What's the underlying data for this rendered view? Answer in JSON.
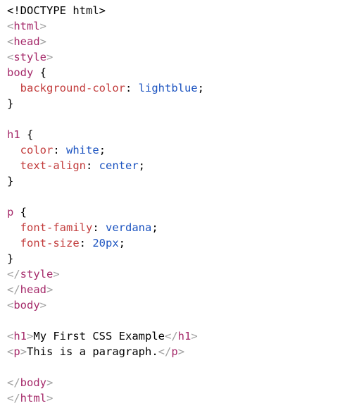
{
  "colors": {
    "plain": "#000000",
    "bracket": "#a0a0a0",
    "tag": "#a52a6a",
    "selector": "#a52a6a",
    "property": "#c23b3b",
    "value": "#1b53c0"
  },
  "code_lines": [
    [
      {
        "t": "plain",
        "v": "<!DOCTYPE html>"
      }
    ],
    [
      {
        "t": "bracket",
        "v": "<"
      },
      {
        "t": "tag",
        "v": "html"
      },
      {
        "t": "bracket",
        "v": ">"
      }
    ],
    [
      {
        "t": "bracket",
        "v": "<"
      },
      {
        "t": "tag",
        "v": "head"
      },
      {
        "t": "bracket",
        "v": ">"
      }
    ],
    [
      {
        "t": "bracket",
        "v": "<"
      },
      {
        "t": "tag",
        "v": "style"
      },
      {
        "t": "bracket",
        "v": ">"
      }
    ],
    [
      {
        "t": "selector",
        "v": "body"
      },
      {
        "t": "punct",
        "v": " {"
      }
    ],
    [
      {
        "t": "plain",
        "v": "  "
      },
      {
        "t": "property",
        "v": "background-color"
      },
      {
        "t": "punct",
        "v": ": "
      },
      {
        "t": "value",
        "v": "lightblue"
      },
      {
        "t": "punct",
        "v": ";"
      }
    ],
    [
      {
        "t": "punct",
        "v": "}"
      }
    ],
    [],
    [
      {
        "t": "selector",
        "v": "h1"
      },
      {
        "t": "punct",
        "v": " {"
      }
    ],
    [
      {
        "t": "plain",
        "v": "  "
      },
      {
        "t": "property",
        "v": "color"
      },
      {
        "t": "punct",
        "v": ": "
      },
      {
        "t": "value",
        "v": "white"
      },
      {
        "t": "punct",
        "v": ";"
      }
    ],
    [
      {
        "t": "plain",
        "v": "  "
      },
      {
        "t": "property",
        "v": "text-align"
      },
      {
        "t": "punct",
        "v": ": "
      },
      {
        "t": "value",
        "v": "center"
      },
      {
        "t": "punct",
        "v": ";"
      }
    ],
    [
      {
        "t": "punct",
        "v": "}"
      }
    ],
    [],
    [
      {
        "t": "selector",
        "v": "p"
      },
      {
        "t": "punct",
        "v": " {"
      }
    ],
    [
      {
        "t": "plain",
        "v": "  "
      },
      {
        "t": "property",
        "v": "font-family"
      },
      {
        "t": "punct",
        "v": ": "
      },
      {
        "t": "value",
        "v": "verdana"
      },
      {
        "t": "punct",
        "v": ";"
      }
    ],
    [
      {
        "t": "plain",
        "v": "  "
      },
      {
        "t": "property",
        "v": "font-size"
      },
      {
        "t": "punct",
        "v": ": "
      },
      {
        "t": "value",
        "v": "20px"
      },
      {
        "t": "punct",
        "v": ";"
      }
    ],
    [
      {
        "t": "punct",
        "v": "}"
      }
    ],
    [
      {
        "t": "bracket",
        "v": "</"
      },
      {
        "t": "tag",
        "v": "style"
      },
      {
        "t": "bracket",
        "v": ">"
      }
    ],
    [
      {
        "t": "bracket",
        "v": "</"
      },
      {
        "t": "tag",
        "v": "head"
      },
      {
        "t": "bracket",
        "v": ">"
      }
    ],
    [
      {
        "t": "bracket",
        "v": "<"
      },
      {
        "t": "tag",
        "v": "body"
      },
      {
        "t": "bracket",
        "v": ">"
      }
    ],
    [],
    [
      {
        "t": "bracket",
        "v": "<"
      },
      {
        "t": "tag",
        "v": "h1"
      },
      {
        "t": "bracket",
        "v": ">"
      },
      {
        "t": "plain",
        "v": "My First CSS Example"
      },
      {
        "t": "bracket",
        "v": "</"
      },
      {
        "t": "tag",
        "v": "h1"
      },
      {
        "t": "bracket",
        "v": ">"
      }
    ],
    [
      {
        "t": "bracket",
        "v": "<"
      },
      {
        "t": "tag",
        "v": "p"
      },
      {
        "t": "bracket",
        "v": ">"
      },
      {
        "t": "plain",
        "v": "This is a paragraph."
      },
      {
        "t": "bracket",
        "v": "</"
      },
      {
        "t": "tag",
        "v": "p"
      },
      {
        "t": "bracket",
        "v": ">"
      }
    ],
    [],
    [
      {
        "t": "bracket",
        "v": "</"
      },
      {
        "t": "tag",
        "v": "body"
      },
      {
        "t": "bracket",
        "v": ">"
      }
    ],
    [
      {
        "t": "bracket",
        "v": "</"
      },
      {
        "t": "tag",
        "v": "html"
      },
      {
        "t": "bracket",
        "v": ">"
      }
    ]
  ]
}
